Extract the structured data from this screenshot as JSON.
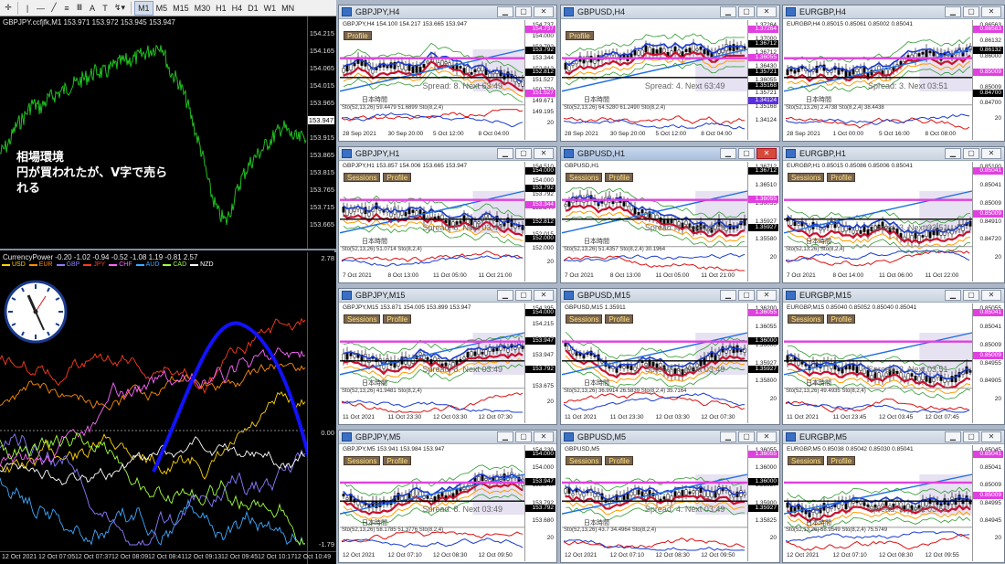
{
  "toolbar": {
    "timeframes": [
      "M1",
      "M5",
      "M15",
      "M30",
      "H1",
      "H4",
      "D1",
      "W1",
      "MN"
    ],
    "active": "M1"
  },
  "main": {
    "title": "GBPJPY.ccfjfk,M1  153.971 153.972 153.945 153.947",
    "price_labels": [
      "154.215",
      "154.165",
      "154.065",
      "154.015",
      "153.965",
      "153.947",
      "153.915",
      "153.865",
      "153.815",
      "153.765",
      "153.715",
      "153.665"
    ],
    "note_lines": [
      "相場環境",
      "円が買われたが、V字で売ら",
      "れる"
    ]
  },
  "indicator": {
    "title": "CurrencyPower -0.20 -1.02 -0.94 -0.52 -1.08 1.19 -0.81 2.57",
    "legend": [
      {
        "name": "USD",
        "color": "#ffd400"
      },
      {
        "name": "EUR",
        "color": "#ff8c00"
      },
      {
        "name": "GBP",
        "color": "#8a7cff"
      },
      {
        "name": "JPY",
        "color": "#ff3b1f"
      },
      {
        "name": "CHF",
        "color": "#ff66ff"
      },
      {
        "name": "AUD",
        "color": "#3fa9ff"
      },
      {
        "name": "CAD",
        "color": "#a0ff3f"
      },
      {
        "name": "NZD",
        "color": "#ffffff"
      }
    ],
    "top_value": "2.78",
    "zero_value": "0.00",
    "bottom_value": "-1.79",
    "time_ticks": [
      "12 Oct 2021",
      "12 Oct 07:05",
      "12 Oct 07:37",
      "12 Oct 08:09",
      "12 Oct 08:41",
      "12 Oct 09:13",
      "12 Oct 09:45",
      "12 Oct 10:17",
      "12 Oct 10:49"
    ]
  },
  "windows": [
    {
      "title": "GBPJPY,H4",
      "header": "GBPJPY,H4  154.100 154.217 153.665 153.947",
      "buttons": [
        "Profile"
      ],
      "spread": "Spread: 8.  Next 63:49",
      "jp": "日本時間",
      "stoch": "Sto(52,13,26) 59.4479 51.6899  Sto(8,2,4)",
      "x": [
        "28 Sep 2021",
        "30 Sep 20:00",
        "5 Oct 12:00",
        "8 Oct 04:00"
      ],
      "axis": [
        "154.737",
        "154.000",
        "153.792",
        "153.344",
        "152.812",
        "151.527",
        "150.779",
        "149.671",
        "149.195",
        "20"
      ],
      "boxes": [
        [
          "154.737",
          "#e040e0",
          "#fff"
        ],
        [
          "153.792",
          "#000",
          "#fff"
        ],
        [
          "152.812",
          "#000",
          "#fff"
        ],
        [
          "151.527",
          "#e040e0",
          "#fff"
        ]
      ]
    },
    {
      "title": "GBPUSD,H4",
      "header": "",
      "buttons": [
        "Profile"
      ],
      "spread": "Spread: 4.  Next 63:49",
      "jp": "日本時間",
      "stoch": "Sto(52,13,26) 64.5280 61.2490  Sto(8,2,4)",
      "x": [
        "28 Sep 2021",
        "30 Sep 20:00",
        "5 Oct 12:00",
        "8 Oct 04:00"
      ],
      "axis": [
        "1.37264",
        "1.37000",
        "1.36712",
        "1.36430",
        "1.36055",
        "1.35721",
        "1.35168",
        "1.34124"
      ],
      "boxes": [
        [
          "1.37264",
          "#e040e0",
          "#fff"
        ],
        [
          "1.36712",
          "#000",
          "#fff"
        ],
        [
          "1.36055",
          "#e040e0",
          "#fff"
        ],
        [
          "1.35721",
          "#000",
          "#fff"
        ],
        [
          "1.35168",
          "#000",
          "#fff"
        ],
        [
          "1.34124",
          "#5a2ee0",
          "#fff"
        ]
      ]
    },
    {
      "title": "EURGBP,H4",
      "header": "EURGBP,H4  0.85015 0.85061 0.85002 0.85041",
      "buttons": [],
      "spread": "Spread: 3.  Next 03:51",
      "jp": "日本時間",
      "stoch": "Sto(52,13,26) 2.4738  Sto(8,2,4) 38.4438",
      "x": [
        "28 Sep 2021",
        "1 Oct 00:00",
        "5 Oct 16:00",
        "8 Oct 08:00"
      ],
      "axis": [
        "0.86563",
        "0.86132",
        "0.86000",
        "0.85600",
        "0.85009",
        "0.84700",
        "20"
      ],
      "boxes": [
        [
          "0.86563",
          "#e040e0",
          "#fff"
        ],
        [
          "0.86132",
          "#000",
          "#fff"
        ],
        [
          "0.85009",
          "#e040e0",
          "#fff"
        ],
        [
          "0.84700",
          "#000",
          "#fff"
        ]
      ]
    },
    {
      "title": "GBPJPY,H1",
      "header": "GBPJPY,H1  153.857 154.006 153.665 153.947",
      "buttons": [
        "Sessions",
        "Profile"
      ],
      "spread": "Spread: 8.  Next 03:49",
      "jp": "日本時間",
      "stoch": "Sto(52,13,26) 51.0714  Sto(8,2,4)",
      "x": [
        "7 Oct 2021",
        "8 Oct 13:00",
        "11 Oct 05:00",
        "11 Oct 21:00"
      ],
      "axis": [
        "154.510",
        "154.000",
        "153.792",
        "153.344",
        "152.812",
        "152.015",
        "152.000",
        "20"
      ],
      "boxes": [
        [
          "154.000",
          "#000",
          "#fff"
        ],
        [
          "153.792",
          "#000",
          "#fff"
        ],
        [
          "153.344",
          "#e040e0",
          "#fff"
        ],
        [
          "152.812",
          "#000",
          "#fff"
        ],
        [
          "152.000",
          "#000",
          "#fff"
        ]
      ]
    },
    {
      "title": "GBPUSD,H1",
      "header": "GBPUSD,H1",
      "buttons": [
        "Sessions",
        "Profile"
      ],
      "spread": "Spread: 4.  Next 03:49",
      "jp": "日本時間",
      "stoch": "Sto(52,13,26) 51.4357  Sto(8,2,4) 30.1964",
      "x": [
        "7 Oct 2021",
        "8 Oct 13:00",
        "11 Oct 05:00",
        "11 Oct 21:00"
      ],
      "axis": [
        "1.36712",
        "1.36510",
        "1.36055",
        "1.35927",
        "1.35580",
        "20"
      ],
      "boxes": [
        [
          "1.36712",
          "#000",
          "#fff"
        ],
        [
          "1.36055",
          "#e040e0",
          "#fff"
        ],
        [
          "1.35927",
          "#000",
          "#fff"
        ]
      ]
    },
    {
      "title": "EURGBP,H1",
      "header": "EURGBP,H1  0.85015 0.85086 0.85006 0.85041",
      "buttons": [
        "Sessions",
        "Profile"
      ],
      "spread": "Spread: 3.  Next 03:51",
      "jp": "日本時間",
      "stoch": "Sto(52,13,26)  Sto(8,2,4)",
      "x": [
        "7 Oct 2021",
        "8 Oct 14:00",
        "11 Oct 06:00",
        "11 Oct 22:00"
      ],
      "axis": [
        "0.85100",
        "0.85041",
        "0.85009",
        "0.84910",
        "0.84720",
        "20"
      ],
      "boxes": [
        [
          "0.85041",
          "#e040e0",
          "#fff"
        ],
        [
          "0.85009",
          "#e040e0",
          "#fff"
        ]
      ]
    },
    {
      "title": "GBPJPY,M15",
      "header": "GBPJPY,M15  153.871 154.005 153.899 153.947",
      "buttons": [
        "Sessions",
        "Profile"
      ],
      "spread": "Spread: 8.  Next 03:49",
      "jp": "日本時間",
      "stoch": "Sto(52,13,26) 41.9481  Sto(8,2,4)",
      "x": [
        "11 Oct 2021",
        "11 Oct 23:30",
        "12 Oct 03:30",
        "12 Oct 07:30"
      ],
      "axis": [
        "154.395",
        "154.215",
        "154.000",
        "153.947",
        "153.792",
        "153.675",
        "20"
      ],
      "boxes": [
        [
          "154.000",
          "#000",
          "#fff"
        ],
        [
          "153.947",
          "#000",
          "#fff"
        ],
        [
          "153.792",
          "#000",
          "#fff"
        ]
      ]
    },
    {
      "title": "GBPUSD,M15",
      "header": "GBPUSD,M15  1.35911",
      "buttons": [
        "Sessions",
        "Profile"
      ],
      "spread": "Spread: 4.  Next 03:49",
      "jp": "日本時間",
      "stoch": "Sto(52,13,26) 36.9914 26.5839  Sto(8,2,4) 35.7164",
      "x": [
        "11 Oct 2021",
        "11 Oct 23:30",
        "12 Oct 03:30",
        "12 Oct 07:30"
      ],
      "axis": [
        "1.36200",
        "1.36055",
        "1.36000",
        "1.35927",
        "1.35800",
        "20"
      ],
      "boxes": [
        [
          "1.36055",
          "#e040e0",
          "#fff"
        ],
        [
          "1.36000",
          "#000",
          "#fff"
        ],
        [
          "1.35927",
          "#000",
          "#fff"
        ]
      ]
    },
    {
      "title": "EURGBP,M15",
      "header": "EURGBP,M15  0.85040 0.85052 0.85040 0.85041",
      "buttons": [
        "Sessions",
        "Profile"
      ],
      "spread": "Spread: 3.  Next 03:51",
      "jp": "日本時間",
      "stoch": "Sto(52,13,26) 49.4935  Sto(8,2,4)",
      "x": [
        "11 Oct 2021",
        "11 Oct 23:45",
        "12 Oct 03:45",
        "12 Oct 07:45"
      ],
      "axis": [
        "0.85055",
        "0.85041",
        "0.85009",
        "0.84955",
        "0.84905",
        "20"
      ],
      "boxes": [
        [
          "0.85041",
          "#e040e0",
          "#fff"
        ],
        [
          "0.85009",
          "#e040e0",
          "#fff"
        ]
      ]
    },
    {
      "title": "GBPJPY,M5",
      "header": "GBPJPY,M5  153.941 153.984 153.947",
      "buttons": [
        "Sessions",
        "Profile"
      ],
      "spread": "Spread: 8.  Next 03:49",
      "jp": "日本時間",
      "stoch": "Sto(52,13,26) 58.1785 51.3776  Sto(8,2,4)",
      "x": [
        "12 Oct 2021",
        "12 Oct 07:10",
        "12 Oct 08:30",
        "12 Oct 09:50"
      ],
      "axis": [
        "154.230",
        "154.000",
        "153.947",
        "153.792",
        "153.680",
        "20"
      ],
      "boxes": [
        [
          "154.000",
          "#000",
          "#fff"
        ],
        [
          "153.947",
          "#000",
          "#fff"
        ],
        [
          "153.792",
          "#000",
          "#fff"
        ]
      ]
    },
    {
      "title": "GBPUSD,M5",
      "header": "GBPUSD,M5",
      "buttons": [
        "Sessions",
        "Profile"
      ],
      "spread": "Spread: 4.  Next 03:49",
      "jp": "日本時間",
      "stoch": "Sto(52,13,26) 43.7 34.4964  Sto(8,2,4)",
      "x": [
        "12 Oct 2021",
        "12 Oct 07:10",
        "12 Oct 08:30",
        "12 Oct 09:50"
      ],
      "axis": [
        "1.36055",
        "1.36000",
        "1.35927",
        "1.35900",
        "1.35825",
        "20"
      ],
      "boxes": [
        [
          "1.36055",
          "#e040e0",
          "#fff"
        ],
        [
          "1.36000",
          "#000",
          "#fff"
        ],
        [
          "1.35927",
          "#000",
          "#fff"
        ]
      ]
    },
    {
      "title": "EURGBP,M5",
      "header": "EURGBP,M5  0.85038 0.85042 0.85030 0.85041",
      "buttons": [
        "Sessions",
        "Profile"
      ],
      "spread": "Spread: 3.  Next 03:51",
      "jp": "日本時間",
      "stoch": "Sto(52,13,26) 58.9549  Sto(8,2,4) 75.5749",
      "x": [
        "12 Oct 2021",
        "12 Oct 07:10",
        "12 Oct 08:30",
        "12 Oct 09:55"
      ],
      "axis": [
        "0.85045",
        "0.85041",
        "0.85009",
        "0.84995",
        "0.84945",
        "20"
      ],
      "boxes": [
        [
          "0.85041",
          "#e040e0",
          "#fff"
        ],
        [
          "0.85009",
          "#e040e0",
          "#fff"
        ]
      ]
    }
  ]
}
